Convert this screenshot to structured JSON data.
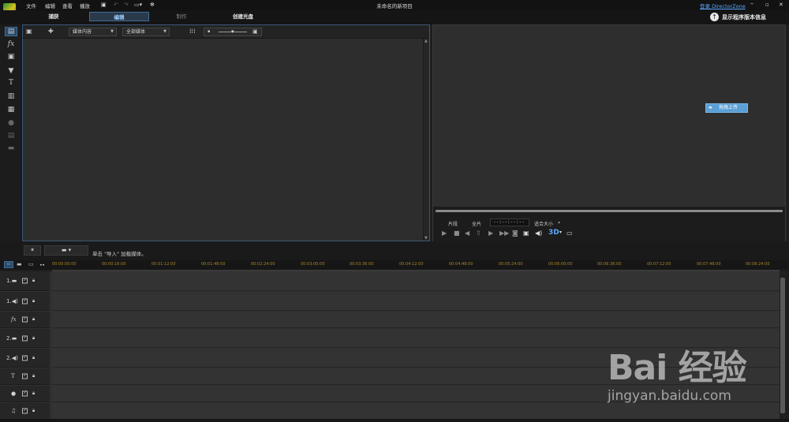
{
  "menu": {
    "items": [
      "文件",
      "编辑",
      "查看",
      "播放"
    ],
    "title": "未命名的新项目",
    "login_link": "登录 DirectorZone",
    "window_controls": [
      "minimize-icon",
      "maximize-icon",
      "close-icon"
    ]
  },
  "modes": {
    "tabs": [
      "捕获",
      "编辑",
      "制作",
      "创建光盘"
    ],
    "active": "编辑",
    "update_notice": "显示程序版本信息"
  },
  "library": {
    "media_content_dropdown": "媒体内容",
    "media_filter_dropdown": "全部媒体",
    "import_hint": "单击 \"导入\" 加载媒体。"
  },
  "preview": {
    "upload_button": "拖拽上传",
    "clip_label": "片段",
    "movie_label": "全片",
    "timecode": "--:--:--:--",
    "fit_dropdown": "适合大小",
    "threed_label": "3D"
  },
  "timeline": {
    "ruler_ticks": [
      "00:00:00:00",
      "00:00:16:00",
      "00:01:12:00",
      "00:01:48:00",
      "00:02:24:00",
      "00:03:00:00",
      "00:03:36:00",
      "00:04:12:00",
      "00:04:48:00",
      "00:05:24:00",
      "00:06:00:00",
      "00:06:36:00",
      "00:07:12:00",
      "00:07:48:00",
      "00:08:24:00"
    ],
    "tracks": [
      {
        "label": "1.",
        "icon": "video-track-icon"
      },
      {
        "label": "1.",
        "icon": "audio-track-icon"
      },
      {
        "label": "fx",
        "icon": "fx-track-icon"
      },
      {
        "label": "2.",
        "icon": "video-track-icon"
      },
      {
        "label": "2.",
        "icon": "audio-track-icon"
      },
      {
        "label": "T",
        "icon": "title-track-icon"
      },
      {
        "label": "",
        "icon": "voice-track-icon"
      },
      {
        "label": "",
        "icon": "music-track-icon"
      }
    ]
  },
  "watermark": {
    "main": "Bai 经验",
    "sub": "jingyan.baidu.com"
  }
}
